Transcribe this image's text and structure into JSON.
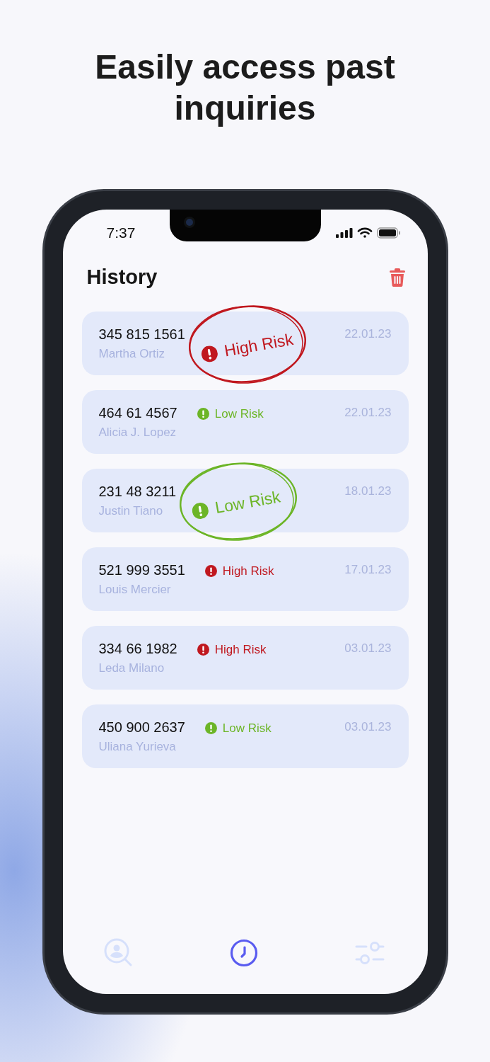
{
  "headline": "Easily access past inquiries",
  "status_bar": {
    "time": "7:37"
  },
  "title": "History",
  "inquiries": [
    {
      "number": "345 815 1561",
      "name": "Martha Ortiz",
      "kind": "high",
      "risk_label": "High Risk",
      "date": "22.01.23",
      "circled": true
    },
    {
      "number": "464 61 4567",
      "name": "Alicia J. Lopez",
      "kind": "low",
      "risk_label": "Low Risk",
      "date": "22.01.23",
      "circled": false
    },
    {
      "number": "231 48 3211",
      "name": "Justin Tiano",
      "kind": "low",
      "risk_label": "Low Risk",
      "date": "18.01.23",
      "circled": true
    },
    {
      "number": "521 999 3551",
      "name": "Louis Mercier",
      "kind": "high",
      "risk_label": "High Risk",
      "date": "17.01.23",
      "circled": false
    },
    {
      "number": "334 66 1982",
      "name": "Leda Milano",
      "kind": "high",
      "risk_label": "High Risk",
      "date": "03.01.23",
      "circled": false
    },
    {
      "number": "450 900 2637",
      "name": "Uliana Yurieva",
      "kind": "low",
      "risk_label": "Low Risk",
      "date": "03.01.23",
      "circled": false
    }
  ],
  "tabs": [
    {
      "kind": "search",
      "selected": false
    },
    {
      "kind": "history",
      "selected": true
    },
    {
      "kind": "settings",
      "selected": false
    }
  ]
}
